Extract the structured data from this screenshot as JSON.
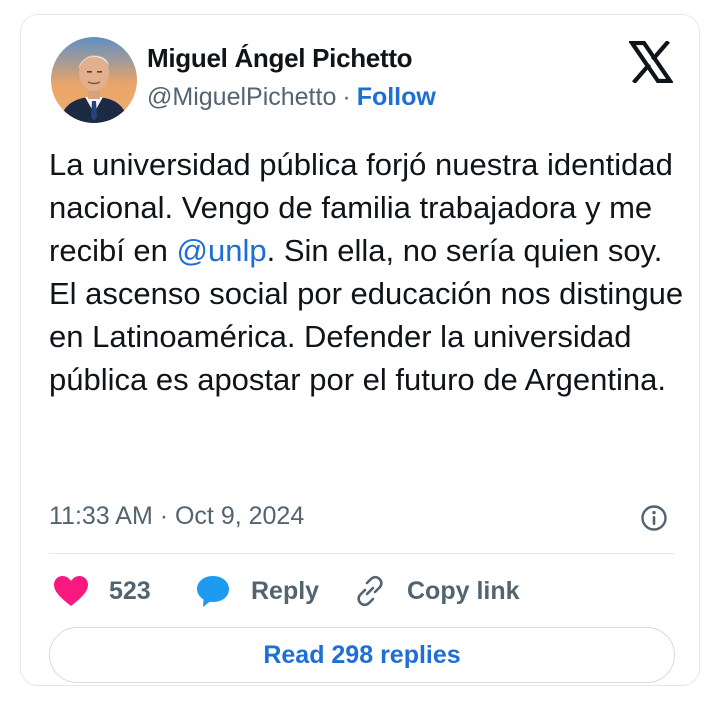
{
  "author": {
    "name": "Miguel Ángel Pichetto",
    "handle": "@MiguelPichetto",
    "separator": "·",
    "follow_label": "Follow"
  },
  "icons": {
    "brand": "x-logo-icon",
    "info": "info-icon",
    "like": "heart-icon",
    "reply": "speech-bubble-icon",
    "copy": "link-icon"
  },
  "tweet": {
    "text_before": "La universidad pública forjó nuestra identidad nacional. Vengo de familia trabajadora y me recibí en ",
    "mention": "@unlp",
    "text_after": ". Sin ella, no sería quien soy. El ascenso social por educación nos distingue en Latinoamérica. Defender la universidad pública es apostar por el futuro de Argentina.",
    "timestamp": "11:33 AM · Oct 9, 2024"
  },
  "actions": {
    "like_count": "523",
    "reply_label": "Reply",
    "copy_label": "Copy link"
  },
  "read_replies_label": "Read 298 replies",
  "colors": {
    "link_blue": "#1d6fd6",
    "like_pink": "#f91880",
    "reply_blue": "#1d9bf0",
    "muted_gray": "#536471",
    "text_black": "#0f1419"
  }
}
